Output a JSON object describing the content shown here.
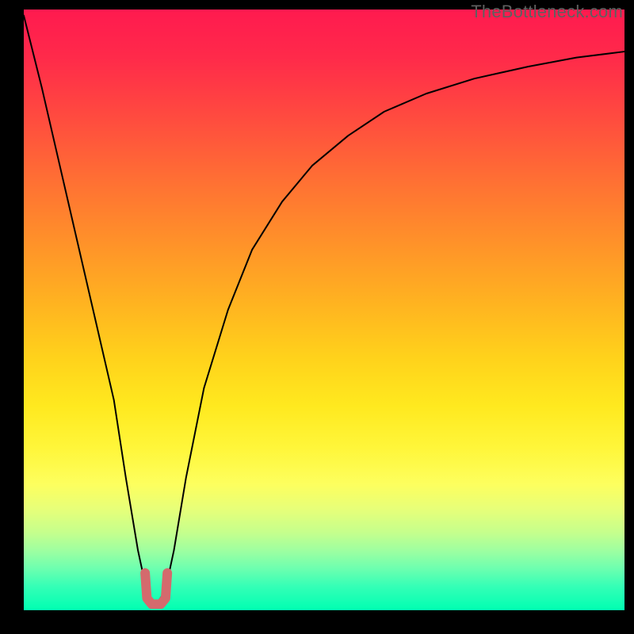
{
  "watermark": "TheBottleneck.com",
  "chart_data": {
    "type": "line",
    "title": "",
    "xlabel": "",
    "ylabel": "",
    "xlim": [
      0,
      100
    ],
    "ylim": [
      0,
      100
    ],
    "grid": false,
    "legend": false,
    "series": [
      {
        "name": "bottleneck-curve",
        "x": [
          0,
          3,
          6,
          9,
          12,
          15,
          17,
          19,
          20.5,
          22,
          23.5,
          25,
          27,
          30,
          34,
          38,
          43,
          48,
          54,
          60,
          67,
          75,
          84,
          92,
          100
        ],
        "y": [
          99,
          87,
          74,
          61,
          48,
          35,
          22,
          10,
          3,
          1,
          3,
          10,
          22,
          37,
          50,
          60,
          68,
          74,
          79,
          83,
          86,
          88.5,
          90.5,
          92,
          93
        ],
        "stroke": "#000000",
        "stroke_width": 2
      },
      {
        "name": "minimum-marker",
        "x": [
          20.2,
          20.5,
          21.3,
          22.8,
          23.6,
          23.9
        ],
        "y": [
          6.2,
          2.0,
          1.0,
          1.0,
          2.0,
          6.2
        ],
        "stroke": "#d46a6d",
        "stroke_width": 12
      }
    ],
    "annotations": []
  }
}
